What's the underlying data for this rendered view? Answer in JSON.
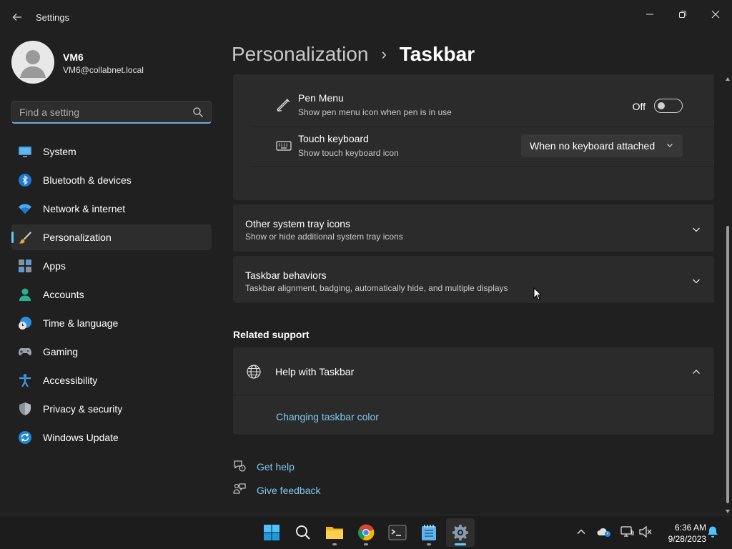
{
  "window": {
    "title": "Settings"
  },
  "profile": {
    "name": "VM6",
    "email": "VM6@collabnet.local"
  },
  "search": {
    "placeholder": "Find a setting"
  },
  "sidebar": {
    "items": [
      {
        "label": "System",
        "icon": "monitor-icon"
      },
      {
        "label": "Bluetooth & devices",
        "icon": "bluetooth-icon"
      },
      {
        "label": "Network & internet",
        "icon": "wifi-icon"
      },
      {
        "label": "Personalization",
        "icon": "paintbrush-icon",
        "active": true
      },
      {
        "label": "Apps",
        "icon": "apps-icon"
      },
      {
        "label": "Accounts",
        "icon": "person-icon"
      },
      {
        "label": "Time & language",
        "icon": "globe-clock-icon"
      },
      {
        "label": "Gaming",
        "icon": "gamepad-icon"
      },
      {
        "label": "Accessibility",
        "icon": "accessibility-icon"
      },
      {
        "label": "Privacy & security",
        "icon": "shield-icon"
      },
      {
        "label": "Windows Update",
        "icon": "update-icon"
      }
    ]
  },
  "breadcrumb": {
    "parent": "Personalization",
    "separator": "›",
    "current": "Taskbar"
  },
  "tray_settings": {
    "pen_menu": {
      "title": "Pen Menu",
      "description": "Show pen menu icon when pen is in use",
      "state_label": "Off",
      "on": false
    },
    "touch_keyboard": {
      "title": "Touch keyboard",
      "description": "Show touch keyboard icon",
      "selected": "When no keyboard attached"
    }
  },
  "sections": {
    "other_tray": {
      "title": "Other system tray icons",
      "description": "Show or hide additional system tray icons"
    },
    "behaviors": {
      "title": "Taskbar behaviors",
      "description": "Taskbar alignment, badging, automatically hide, and multiple displays"
    }
  },
  "related_support": {
    "heading": "Related support",
    "help": {
      "title": "Help with Taskbar",
      "link": "Changing taskbar color"
    }
  },
  "footer_links": {
    "get_help": "Get help",
    "give_feedback": "Give feedback"
  },
  "taskbar": {
    "apps": [
      "windows-start-icon",
      "search-icon",
      "file-explorer-icon",
      "chrome-icon",
      "terminal-icon",
      "notepad-icon",
      "settings-gear-icon"
    ],
    "active_app": "settings-gear-icon",
    "clock": {
      "time": "6:36 AM",
      "date": "9/28/2023"
    }
  },
  "colors": {
    "accent": "#60cdff",
    "link": "#7ec8ee",
    "background": "#202020",
    "card": "#2b2b2b"
  }
}
